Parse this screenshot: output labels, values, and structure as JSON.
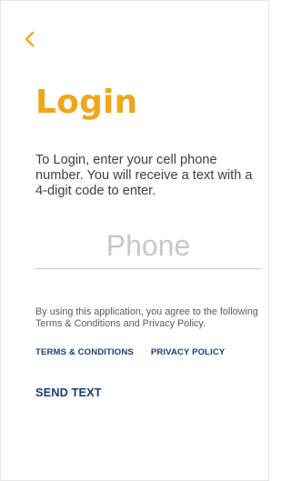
{
  "header": {
    "back_icon": "chevron-left-icon"
  },
  "login": {
    "title": "Login",
    "instructions": "To Login, enter your cell phone number. You will receive a text with a 4-digit code to enter.",
    "phone": {
      "value": "",
      "placeholder": "Phone"
    },
    "disclaimer": "By using this application, you agree to the following Terms & Conditions and Privacy Policy.",
    "links": {
      "terms_label": "TERMS & CONDITIONS",
      "privacy_label": "PRIVACY POLICY"
    },
    "send_label": "SEND TEXT"
  },
  "colors": {
    "accent": "#f0a61b",
    "link": "#1c3f78",
    "text": "#3f3f3f",
    "placeholder": "#c8c8c8",
    "divider": "#c9c9c9"
  }
}
